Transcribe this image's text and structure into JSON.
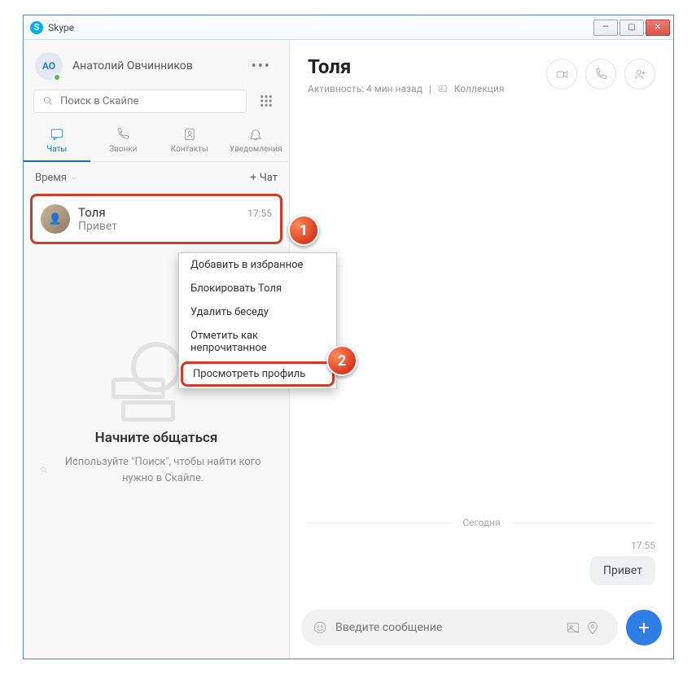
{
  "window": {
    "title": "Skype"
  },
  "profile": {
    "initials": "АО",
    "name": "Анатолий Овчинников"
  },
  "search": {
    "placeholder": "Поиск в Скайпе"
  },
  "tabs": {
    "chats": "Чаты",
    "calls": "Звонки",
    "contacts": "Контакты",
    "notifications": "Уведомления"
  },
  "filter": {
    "label": "Время",
    "new_chat": "Чат"
  },
  "chat_item": {
    "name": "Толя",
    "preview": "Привет",
    "time": "17:55"
  },
  "markers": {
    "one": "1",
    "two": "2"
  },
  "context_menu": {
    "favorite": "Добавить в избранное",
    "block": "Блокировать Толя",
    "delete": "Удалить беседу",
    "unread": "Отметить как непрочитанное",
    "profile": "Просмотреть профиль"
  },
  "empty": {
    "title": "Начните общаться",
    "text": "Используйте \"Поиск\", чтобы найти кого нужно в Скайпе."
  },
  "conversation": {
    "title": "Толя",
    "activity": "Активность: 4 мин назад",
    "collection": "Коллекция",
    "day": "Сегодня",
    "msg_time": "17:55",
    "msg_text": "Привет"
  },
  "composer": {
    "placeholder": "Введите сообщение"
  }
}
